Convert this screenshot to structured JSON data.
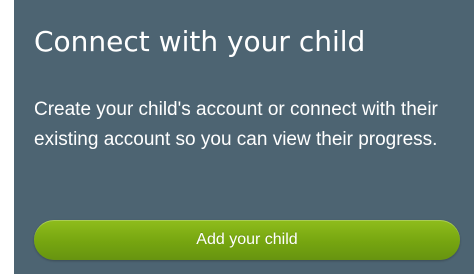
{
  "card": {
    "title": "Connect with your child",
    "description": "Create your child's account or connect with their existing account so you can view their progress.",
    "add_child_button_label": "Add your child"
  },
  "colors": {
    "card_background": "#4d6472",
    "button_green": "#76a510",
    "text": "#ffffff"
  }
}
